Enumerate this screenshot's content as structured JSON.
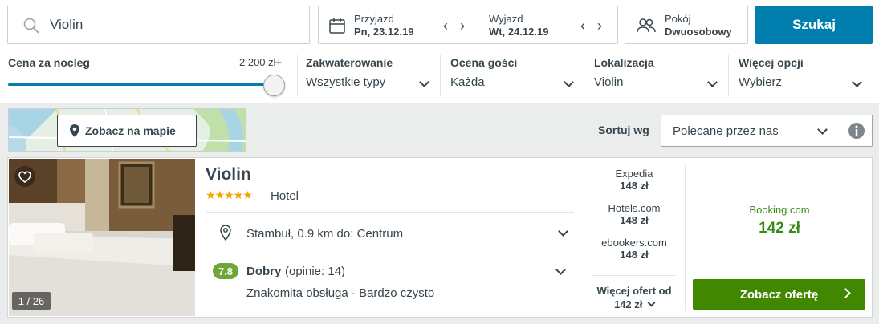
{
  "search": {
    "value": "Violin",
    "button_label": "Szukaj"
  },
  "dates": {
    "checkin_label": "Przyjazd",
    "checkin_value": "Pn, 23.12.19",
    "checkout_label": "Wyjazd",
    "checkout_value": "Wt, 24.12.19"
  },
  "room": {
    "label": "Pokój",
    "value": "Dwuosobowy"
  },
  "filters": {
    "price_label": "Cena za nocleg",
    "price_max": "2 200 zł+",
    "price_slider_level": 1.0,
    "accommodation_label": "Zakwaterowanie",
    "accommodation_value": "Wszystkie typy",
    "rating_label": "Ocena gości",
    "rating_value": "Każda",
    "location_label": "Lokalizacja",
    "location_value": "Violin",
    "more_label": "Więcej opcji",
    "more_value": "Wybierz"
  },
  "map": {
    "button_label": "Zobacz na mapie"
  },
  "sort": {
    "label": "Sortuj wg",
    "value": "Polecane przez nas"
  },
  "hotel": {
    "name": "Violin",
    "stars": "★★★★★",
    "star_count": 5,
    "type": "Hotel",
    "photo_count": "1 / 26",
    "location": "Stambuł, 0.9 km do: Centrum",
    "rating_score": "7.8",
    "rating_word": "Dobry",
    "rating_count": "(opinie: 14)",
    "rating_tags": "Znakomita obsługa · Bardzo czysto",
    "providers": [
      {
        "name": "Expedia",
        "price": "148 zł"
      },
      {
        "name": "Hotels.com",
        "price": "148 zł"
      },
      {
        "name": "ebookers.com",
        "price": "148 zł"
      }
    ],
    "more_offers_label": "Więcej ofert od",
    "more_offers_price": "142 zł",
    "best_provider": "Booking.com",
    "best_price": "142 zł",
    "offer_button": "Zobacz ofertę"
  },
  "colors": {
    "brand_blue": "#007faf",
    "deal_green": "#428700",
    "price_green": "#3b8b1c",
    "rating_green": "#6da736",
    "star_gold": "#f0a500"
  }
}
